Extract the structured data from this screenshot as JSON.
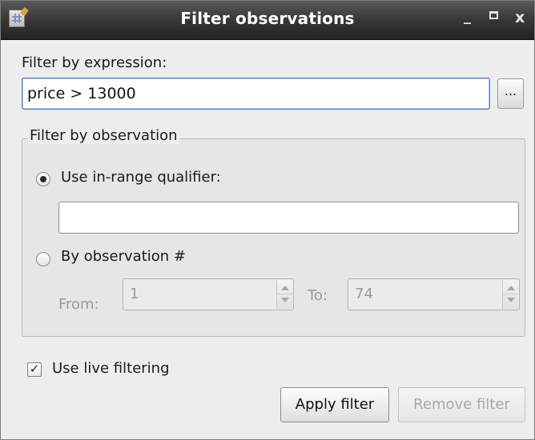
{
  "window": {
    "title": "Filter observations",
    "controls": {
      "minimize": "_",
      "maximize": "□",
      "close": "x"
    }
  },
  "expression": {
    "label": "Filter by expression:",
    "value": "price > 13000",
    "browse_label": "..."
  },
  "observation_group": {
    "title": "Filter by observation",
    "in_range": {
      "label": "Use in-range qualifier:",
      "checked": true,
      "value": ""
    },
    "by_number": {
      "label": "By observation #",
      "checked": false
    },
    "from": {
      "label": "From:",
      "value": "1"
    },
    "to": {
      "label": "To:",
      "value": "74"
    }
  },
  "live_filtering": {
    "label": "Use live filtering",
    "checked": true,
    "checkmark": "✓"
  },
  "buttons": {
    "apply": "Apply filter",
    "remove": "Remove filter"
  },
  "colors": {
    "accent": "#4f7fc8",
    "titlebar": "#2b2b2b",
    "disabled_text": "#9a9a9a"
  }
}
